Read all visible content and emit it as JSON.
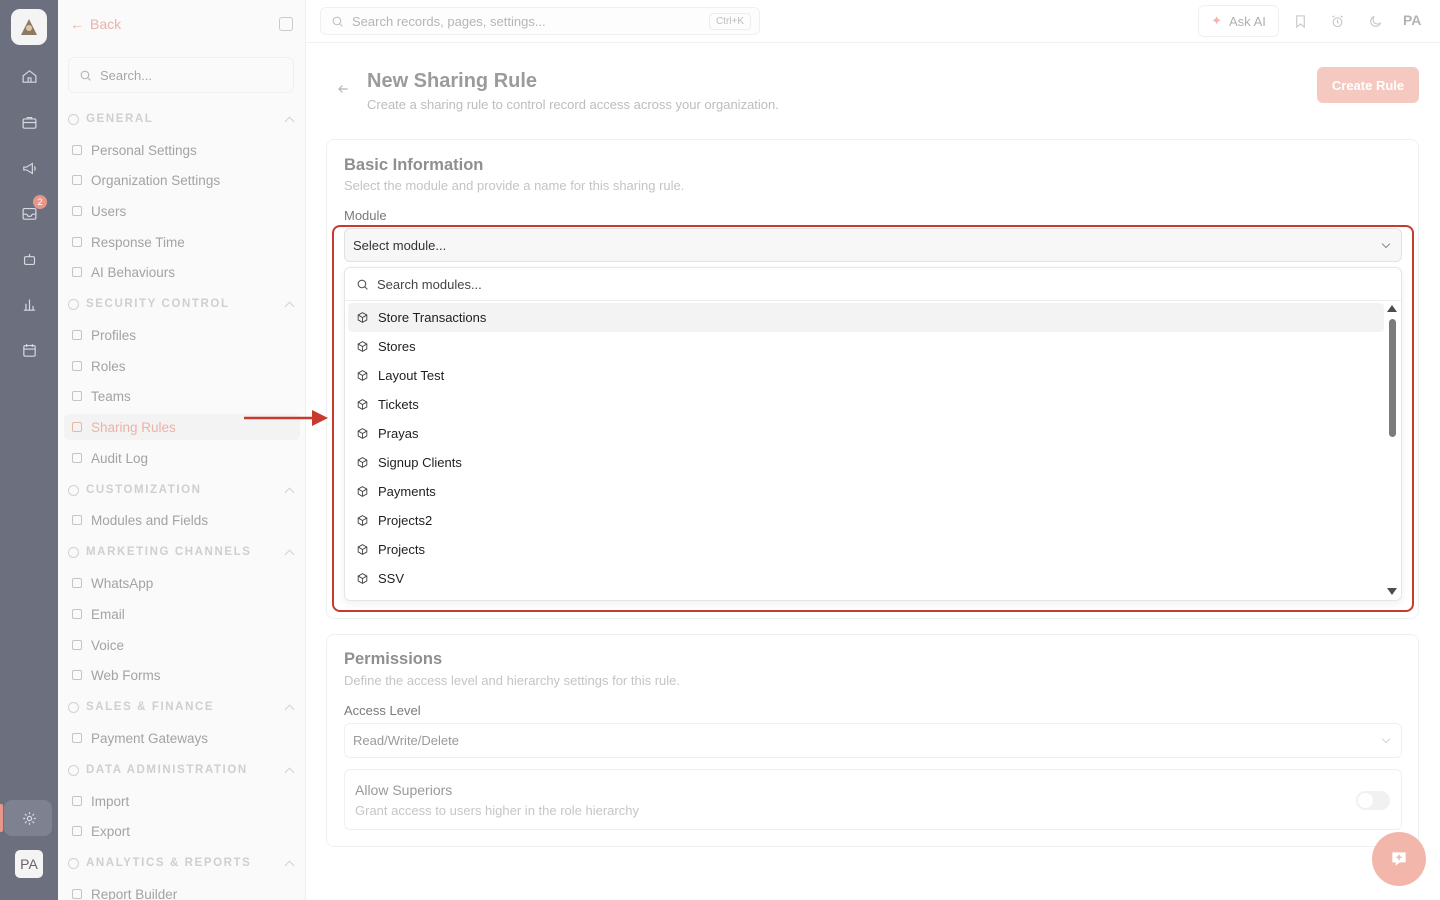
{
  "rail": {
    "badge_count": "2",
    "avatar_initials": "PA"
  },
  "sidebar": {
    "back_label": "Back",
    "search_placeholder": "Search...",
    "sections": [
      {
        "title": "GENERAL",
        "items": [
          "Personal Settings",
          "Organization Settings",
          "Users",
          "Response Time",
          "AI Behaviours"
        ]
      },
      {
        "title": "SECURITY CONTROL",
        "items": [
          "Profiles",
          "Roles",
          "Teams",
          "Sharing Rules",
          "Audit Log"
        ]
      },
      {
        "title": "CUSTOMIZATION",
        "items": [
          "Modules and Fields"
        ]
      },
      {
        "title": "MARKETING CHANNELS",
        "items": [
          "WhatsApp",
          "Email",
          "Voice",
          "Web Forms"
        ]
      },
      {
        "title": "SALES & FINANCE",
        "items": [
          "Payment Gateways"
        ]
      },
      {
        "title": "DATA ADMINISTRATION",
        "items": [
          "Import",
          "Export"
        ]
      },
      {
        "title": "ANALYTICS & REPORTS",
        "items": [
          "Report Builder"
        ]
      }
    ],
    "active_item": "Sharing Rules"
  },
  "topbar": {
    "search_placeholder": "Search records, pages, settings...",
    "shortcut": "Ctrl+K",
    "ask_ai_label": "Ask AI",
    "user_initials": "PA"
  },
  "page": {
    "title": "New Sharing Rule",
    "subtitle": "Create a sharing rule to control record access across your organization.",
    "create_button": "Create Rule"
  },
  "basic_info": {
    "title": "Basic Information",
    "subtitle": "Select the module and provide a name for this sharing rule.",
    "module_label": "Module",
    "module_placeholder": "Select module...",
    "dropdown_search_placeholder": "Search modules...",
    "modules": [
      "Store Transactions",
      "Stores",
      "Layout Test",
      "Tickets",
      "Prayas",
      "Signup Clients",
      "Payments",
      "Projects2",
      "Projects",
      "SSV"
    ],
    "highlighted_module": "Store Transactions"
  },
  "permissions": {
    "title": "Permissions",
    "subtitle": "Define the access level and hierarchy settings for this rule.",
    "access_label": "Access Level",
    "access_value": "Read/Write/Delete",
    "superiors_title": "Allow Superiors",
    "superiors_sub": "Grant access to users higher in the role hierarchy",
    "superiors_enabled": false
  },
  "colors": {
    "accent": "#f6c9c0",
    "highlight_box": "#c8392e",
    "rail": "#6b6f7e"
  }
}
